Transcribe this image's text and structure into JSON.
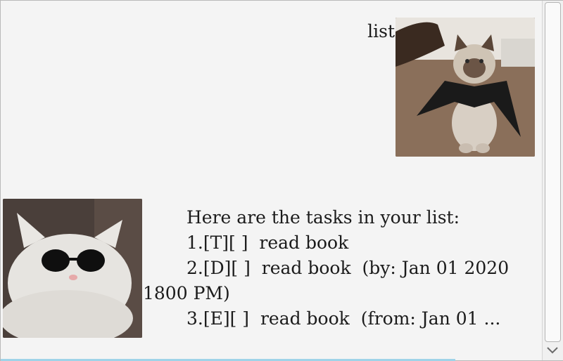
{
  "user_dialog": {
    "text": "list",
    "avatar_icon": "siamese-cat-bat-costume-image"
  },
  "duke_dialog": {
    "avatar_icon": "white-cat-sunglasses-image",
    "lines": [
      "Here are the tasks in your list:",
      "1.[T][ ]  read book",
      "2.[D][ ]  read book  (by: Jan 01 2020 1800 PM)",
      "3.[E][ ]  read book  (from: Jan 01 ..."
    ]
  },
  "scrollbar": {
    "down_icon": "chevron-down-icon"
  },
  "colors": {
    "background": "#f4f4f4",
    "input_focus": "#9fd3e8"
  }
}
